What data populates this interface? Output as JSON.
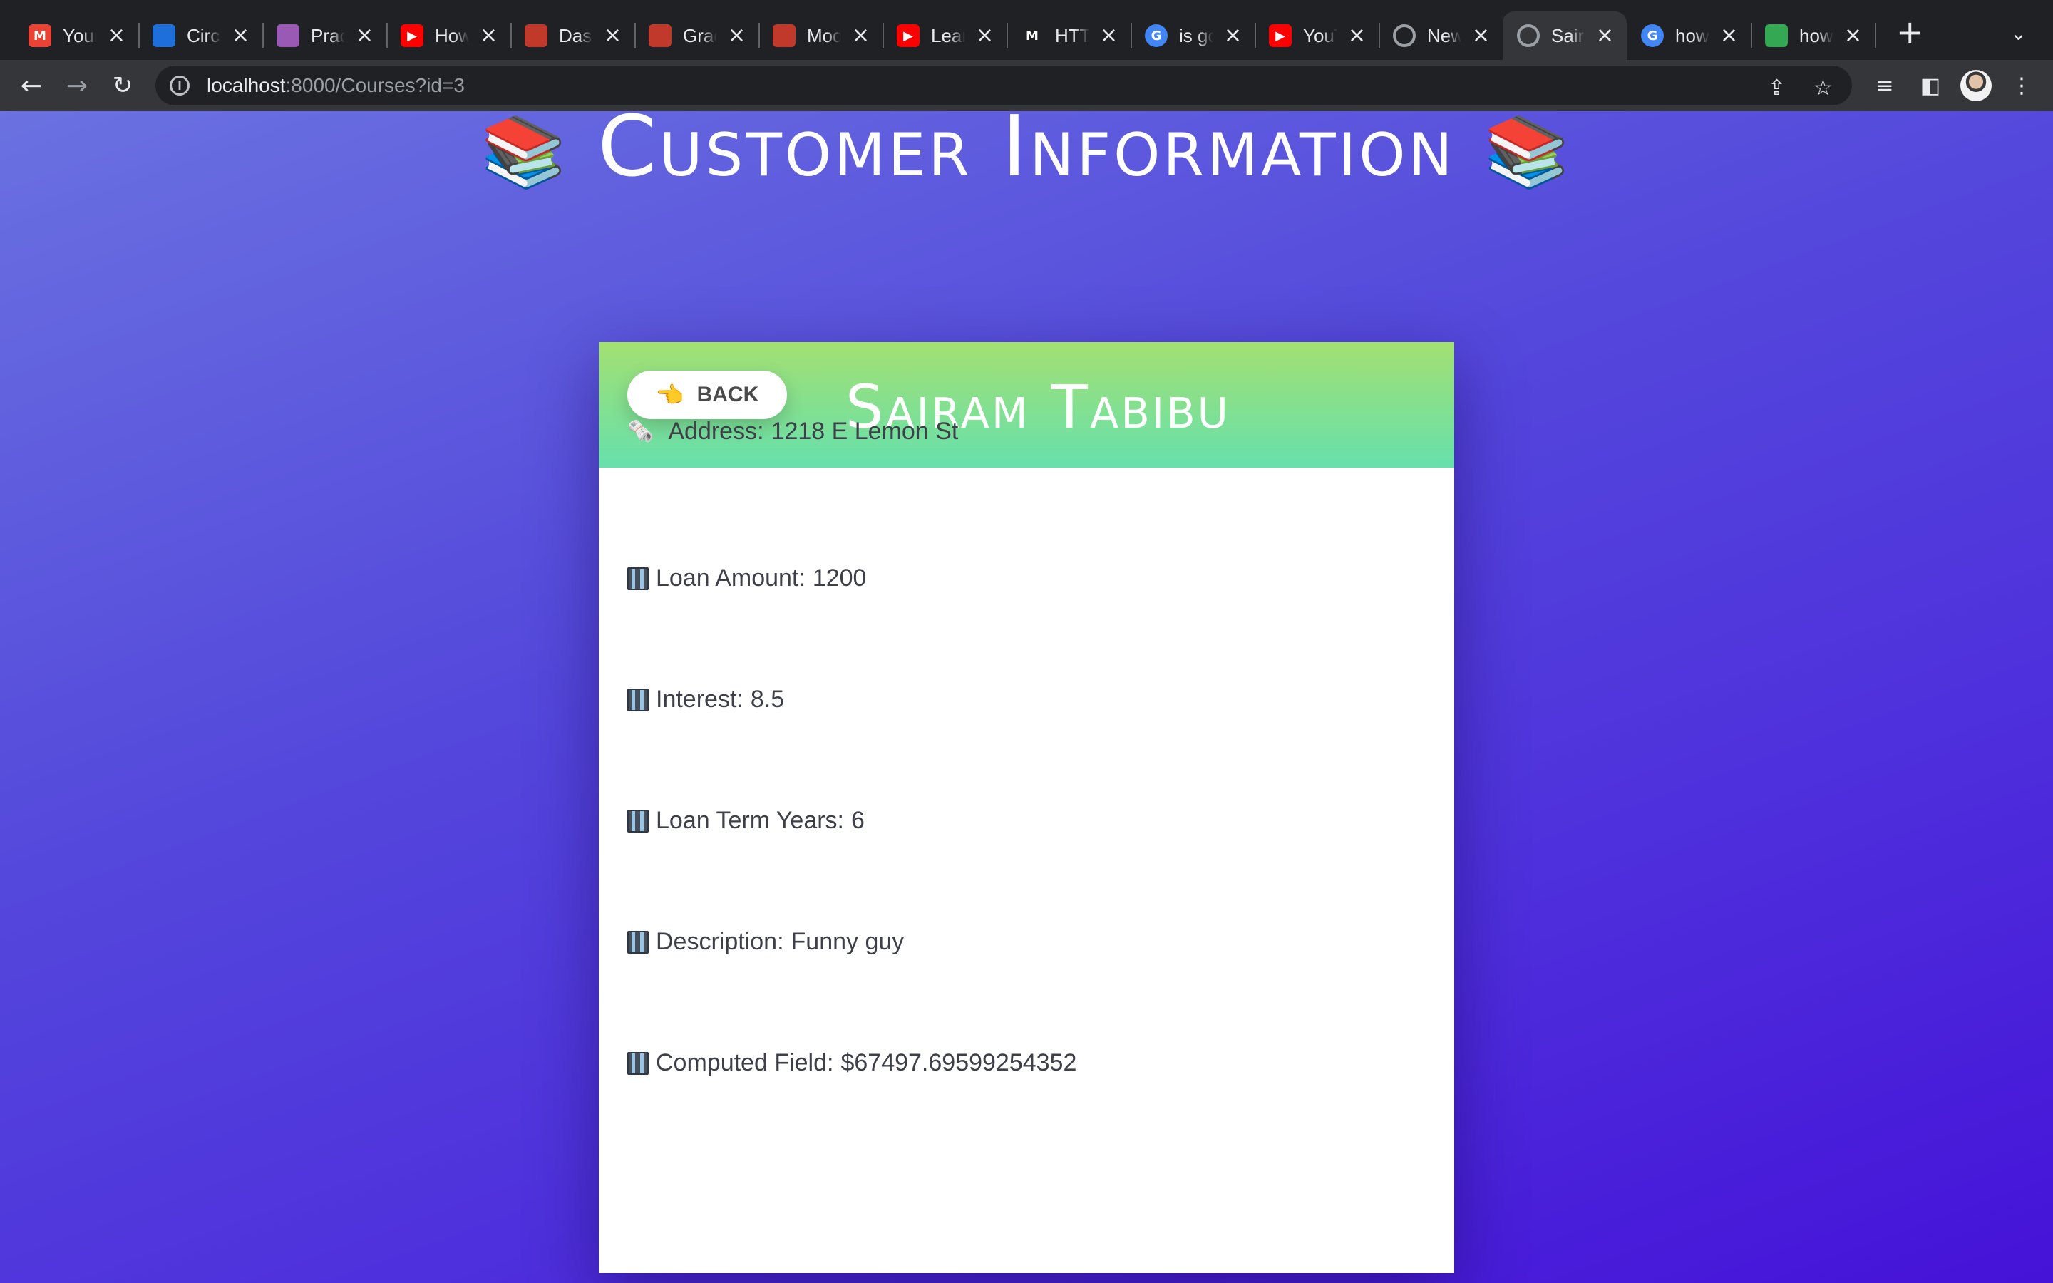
{
  "browser": {
    "tabs": [
      {
        "title": "Your",
        "favicon": "gmail-icon",
        "color": "#ea4335"
      },
      {
        "title": "Circl",
        "favicon": "circleci-icon",
        "color": "#1e6fd9"
      },
      {
        "title": "Prac",
        "favicon": "rocket-icon",
        "color": "#9b59b6"
      },
      {
        "title": "How",
        "favicon": "youtube-icon",
        "color": "#ff0000"
      },
      {
        "title": "Dash",
        "favicon": "ironhack-icon",
        "color": "#c0392b"
      },
      {
        "title": "Grad",
        "favicon": "ironhack-icon",
        "color": "#c0392b"
      },
      {
        "title": "Mod",
        "favicon": "ironhack-icon",
        "color": "#c0392b"
      },
      {
        "title": "Lear",
        "favicon": "youtube-icon",
        "color": "#ff0000"
      },
      {
        "title": "HTT",
        "favicon": "medium-icon",
        "color": "#ffffff"
      },
      {
        "title": "is go",
        "favicon": "google-icon",
        "color": "#4285f4"
      },
      {
        "title": "YouT",
        "favicon": "youtube-icon",
        "color": "#ff0000"
      },
      {
        "title": "New",
        "favicon": "chrome-icon",
        "color": "#9aa0a6"
      },
      {
        "title": "Sairi",
        "favicon": "globe-icon",
        "color": "#9aa0a6",
        "active": true
      },
      {
        "title": "how",
        "favicon": "google-icon",
        "color": "#4285f4"
      },
      {
        "title": "how",
        "favicon": "colorful-icon",
        "color": "#34a853"
      }
    ],
    "url_host": "localhost",
    "url_rest": ":8000/Courses?id=3"
  },
  "page": {
    "title": "Customer Information",
    "title_emoji": "📚"
  },
  "card": {
    "back_label": "BACK",
    "back_emoji": "👈",
    "customer_name": "Sairam Tabibu",
    "fields": [
      {
        "emoji": "🗞️",
        "label": "Address:",
        "value": "1218 E Lemon St"
      },
      {
        "emoji": "building-icon",
        "label": "Loan Amount:",
        "value": "1200"
      },
      {
        "emoji": "building-icon",
        "label": "Interest:",
        "value": "8.5"
      },
      {
        "emoji": "building-icon",
        "label": "Loan Term Years:",
        "value": "6"
      },
      {
        "emoji": "building-icon",
        "label": "Description:",
        "value": "Funny guy"
      },
      {
        "emoji": "building-icon",
        "label": "Computed Field:",
        "value": "$67497.69599254352"
      }
    ]
  }
}
